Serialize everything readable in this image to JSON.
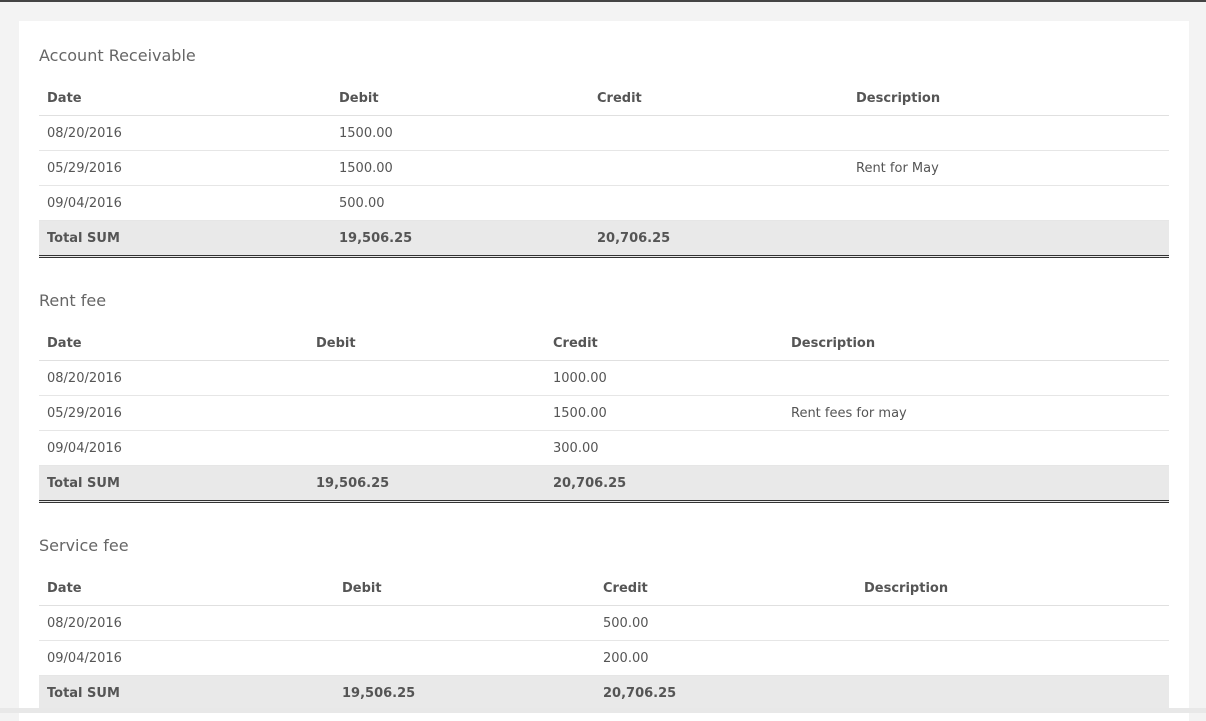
{
  "sections": [
    {
      "title": "Account Receivable",
      "headers": [
        "Date",
        "Debit",
        "Credit",
        "Description"
      ],
      "rows": [
        [
          "08/20/2016",
          "1500.00",
          "",
          ""
        ],
        [
          "05/29/2016",
          "1500.00",
          "",
          "Rent for May"
        ],
        [
          "09/04/2016",
          "500.00",
          "",
          ""
        ]
      ],
      "total": [
        "Total SUM",
        "19,506.25",
        "20,706.25",
        ""
      ]
    },
    {
      "title": "Rent fee",
      "headers": [
        "Date",
        "Debit",
        "Credit",
        "Description"
      ],
      "rows": [
        [
          "08/20/2016",
          "",
          "1000.00",
          ""
        ],
        [
          "05/29/2016",
          "",
          "1500.00",
          "Rent fees for may"
        ],
        [
          "09/04/2016",
          "",
          "300.00",
          ""
        ]
      ],
      "total": [
        "Total SUM",
        "19,506.25",
        "20,706.25",
        ""
      ]
    },
    {
      "title": "Service fee",
      "headers": [
        "Date",
        "Debit",
        "Credit",
        "Description"
      ],
      "rows": [
        [
          "08/20/2016",
          "",
          "500.00",
          ""
        ],
        [
          "09/04/2016",
          "",
          "200.00",
          ""
        ]
      ],
      "total": [
        "Total SUM",
        "19,506.25",
        "20,706.25",
        ""
      ]
    }
  ]
}
